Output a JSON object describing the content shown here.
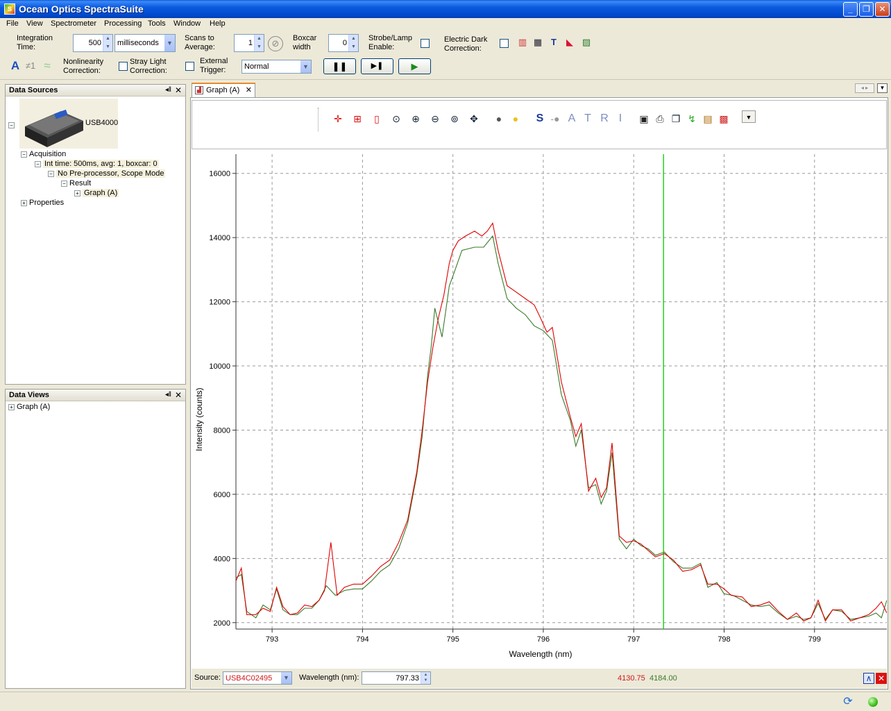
{
  "window": {
    "title": "Ocean Optics SpectraSuite",
    "minimize": "_",
    "restore": "❐",
    "close": "✕"
  },
  "menu": {
    "file": "File",
    "view": "View",
    "spectrometer": "Spectrometer",
    "processing": "Processing",
    "tools": "Tools",
    "window": "Window",
    "help": "Help"
  },
  "toolbar": {
    "integration_time_label": "Integration Time:",
    "integration_time_value": "500",
    "integration_unit": "milliseconds",
    "scans_to_average_label": "Scans to Average:",
    "scans_to_average_value": "1",
    "boxcar_label": "Boxcar width",
    "boxcar_value": "0",
    "strobe_label": "Strobe/Lamp Enable:",
    "electric_dark_label": "Electric Dark Correction:",
    "nonlinearity_label": "Nonlinearity Correction:",
    "stray_light_label": "Stray Light Correction:",
    "external_trigger_label": "External Trigger:",
    "trigger_mode": "Normal"
  },
  "data_sources": {
    "title": "Data Sources",
    "device": "USB4000",
    "acquisition": "Acquisition",
    "int_time": "Int time: 500ms, avg: 1, boxcar: 0",
    "preprocessor": "No Pre-processor, Scope Mode",
    "result": "Result",
    "graph": "Graph (A)",
    "properties": "Properties"
  },
  "data_views": {
    "title": "Data Views",
    "graph": "Graph (A)"
  },
  "graph_tab": {
    "label": "Graph (A)"
  },
  "graph_toolbar_letters": {
    "s": "S",
    "a": "A",
    "t": "T",
    "r": "R",
    "i": "I"
  },
  "footer": {
    "source_label": "Source:",
    "source_value": "USB4C02495",
    "wavelength_label": "Wavelength (nm):",
    "wavelength_value": "797.33",
    "cursor_red": "4130.75",
    "cursor_green": "4184.00"
  },
  "colors": {
    "red_series": "#e00000",
    "green_series": "#3a7a2a",
    "cursor": "#00cc00"
  },
  "chart_data": {
    "type": "line",
    "xlabel": "Wavelength (nm)",
    "ylabel": "Intensity (counts)",
    "xlim": [
      792.6,
      799.8
    ],
    "ylim": [
      1800,
      16600
    ],
    "xticks": [
      793,
      794,
      795,
      796,
      797,
      798,
      799
    ],
    "yticks": [
      2000,
      4000,
      6000,
      8000,
      10000,
      12000,
      14000,
      16000
    ],
    "grid": true,
    "cursor_x": 797.33,
    "series": [
      {
        "color": "#e00000",
        "points": [
          [
            792.6,
            3300
          ],
          [
            792.66,
            3700
          ],
          [
            792.72,
            2250
          ],
          [
            792.82,
            2250
          ],
          [
            792.9,
            2450
          ],
          [
            792.98,
            2350
          ],
          [
            793.05,
            3100
          ],
          [
            793.12,
            2500
          ],
          [
            793.2,
            2250
          ],
          [
            793.28,
            2300
          ],
          [
            793.36,
            2550
          ],
          [
            793.44,
            2500
          ],
          [
            793.52,
            2700
          ],
          [
            793.58,
            3000
          ],
          [
            793.65,
            4500
          ],
          [
            793.72,
            2850
          ],
          [
            793.8,
            3100
          ],
          [
            793.9,
            3200
          ],
          [
            794.0,
            3200
          ],
          [
            794.1,
            3450
          ],
          [
            794.2,
            3750
          ],
          [
            794.3,
            3950
          ],
          [
            794.4,
            4500
          ],
          [
            794.5,
            5200
          ],
          [
            794.6,
            6700
          ],
          [
            794.66,
            8000
          ],
          [
            794.72,
            9500
          ],
          [
            794.78,
            10600
          ],
          [
            794.84,
            11500
          ],
          [
            794.9,
            12200
          ],
          [
            794.96,
            13200
          ],
          [
            795.0,
            13600
          ],
          [
            795.06,
            13900
          ],
          [
            795.14,
            14050
          ],
          [
            795.24,
            14200
          ],
          [
            795.32,
            14050
          ],
          [
            795.38,
            14200
          ],
          [
            795.44,
            14450
          ],
          [
            795.5,
            13600
          ],
          [
            795.6,
            12500
          ],
          [
            795.7,
            12300
          ],
          [
            795.8,
            12100
          ],
          [
            795.9,
            11900
          ],
          [
            795.96,
            11550
          ],
          [
            796.04,
            11050
          ],
          [
            796.1,
            11200
          ],
          [
            796.2,
            9500
          ],
          [
            796.3,
            8400
          ],
          [
            796.36,
            7800
          ],
          [
            796.42,
            8200
          ],
          [
            796.5,
            6100
          ],
          [
            796.58,
            6500
          ],
          [
            796.64,
            5900
          ],
          [
            796.7,
            6200
          ],
          [
            796.76,
            7600
          ],
          [
            796.84,
            4700
          ],
          [
            796.92,
            4500
          ],
          [
            797.0,
            4550
          ],
          [
            797.08,
            4450
          ],
          [
            797.16,
            4250
          ],
          [
            797.24,
            4050
          ],
          [
            797.34,
            4150
          ],
          [
            797.44,
            3950
          ],
          [
            797.54,
            3600
          ],
          [
            797.64,
            3650
          ],
          [
            797.74,
            3800
          ],
          [
            797.82,
            3200
          ],
          [
            797.92,
            3200
          ],
          [
            798.0,
            3050
          ],
          [
            798.08,
            2850
          ],
          [
            798.2,
            2800
          ],
          [
            798.3,
            2500
          ],
          [
            798.4,
            2550
          ],
          [
            798.5,
            2650
          ],
          [
            798.6,
            2350
          ],
          [
            798.7,
            2100
          ],
          [
            798.8,
            2300
          ],
          [
            798.88,
            2050
          ],
          [
            798.96,
            2150
          ],
          [
            799.04,
            2700
          ],
          [
            799.12,
            2050
          ],
          [
            799.2,
            2400
          ],
          [
            799.3,
            2400
          ],
          [
            799.4,
            2050
          ],
          [
            799.5,
            2150
          ],
          [
            799.6,
            2250
          ],
          [
            799.68,
            2450
          ],
          [
            799.74,
            2650
          ],
          [
            799.8,
            2300
          ]
        ]
      },
      {
        "color": "#3a7a2a",
        "points": [
          [
            792.6,
            3400
          ],
          [
            792.66,
            3500
          ],
          [
            792.72,
            2350
          ],
          [
            792.82,
            2150
          ],
          [
            792.9,
            2550
          ],
          [
            792.98,
            2400
          ],
          [
            793.05,
            3050
          ],
          [
            793.12,
            2400
          ],
          [
            793.2,
            2250
          ],
          [
            793.28,
            2250
          ],
          [
            793.36,
            2450
          ],
          [
            793.44,
            2450
          ],
          [
            793.52,
            2700
          ],
          [
            793.6,
            3150
          ],
          [
            793.7,
            2850
          ],
          [
            793.8,
            3000
          ],
          [
            793.9,
            3050
          ],
          [
            794.0,
            3050
          ],
          [
            794.1,
            3300
          ],
          [
            794.2,
            3600
          ],
          [
            794.3,
            3800
          ],
          [
            794.4,
            4300
          ],
          [
            794.5,
            5100
          ],
          [
            794.6,
            6600
          ],
          [
            794.66,
            7800
          ],
          [
            794.72,
            9700
          ],
          [
            794.76,
            10600
          ],
          [
            794.8,
            11800
          ],
          [
            794.88,
            10900
          ],
          [
            794.96,
            12500
          ],
          [
            795.0,
            12800
          ],
          [
            795.1,
            13600
          ],
          [
            795.24,
            13700
          ],
          [
            795.34,
            13700
          ],
          [
            795.44,
            14050
          ],
          [
            795.5,
            13200
          ],
          [
            795.6,
            12100
          ],
          [
            795.7,
            11800
          ],
          [
            795.8,
            11600
          ],
          [
            795.9,
            11250
          ],
          [
            796.0,
            11100
          ],
          [
            796.1,
            10800
          ],
          [
            796.2,
            9100
          ],
          [
            796.3,
            8300
          ],
          [
            796.36,
            7500
          ],
          [
            796.42,
            8000
          ],
          [
            796.5,
            6200
          ],
          [
            796.58,
            6300
          ],
          [
            796.64,
            5700
          ],
          [
            796.7,
            6100
          ],
          [
            796.76,
            7300
          ],
          [
            796.84,
            4600
          ],
          [
            796.92,
            4300
          ],
          [
            797.0,
            4600
          ],
          [
            797.08,
            4400
          ],
          [
            797.16,
            4300
          ],
          [
            797.24,
            4100
          ],
          [
            797.34,
            4200
          ],
          [
            797.44,
            3900
          ],
          [
            797.54,
            3700
          ],
          [
            797.64,
            3700
          ],
          [
            797.74,
            3850
          ],
          [
            797.82,
            3100
          ],
          [
            797.92,
            3250
          ],
          [
            798.0,
            2900
          ],
          [
            798.1,
            2850
          ],
          [
            798.2,
            2700
          ],
          [
            798.3,
            2550
          ],
          [
            798.4,
            2500
          ],
          [
            798.5,
            2550
          ],
          [
            798.6,
            2300
          ],
          [
            798.7,
            2100
          ],
          [
            798.8,
            2200
          ],
          [
            798.88,
            2100
          ],
          [
            798.96,
            2150
          ],
          [
            799.04,
            2600
          ],
          [
            799.12,
            2100
          ],
          [
            799.2,
            2400
          ],
          [
            799.3,
            2350
          ],
          [
            799.4,
            2100
          ],
          [
            799.5,
            2150
          ],
          [
            799.6,
            2200
          ],
          [
            799.68,
            2300
          ],
          [
            799.74,
            2150
          ],
          [
            799.8,
            2700
          ]
        ]
      }
    ]
  }
}
